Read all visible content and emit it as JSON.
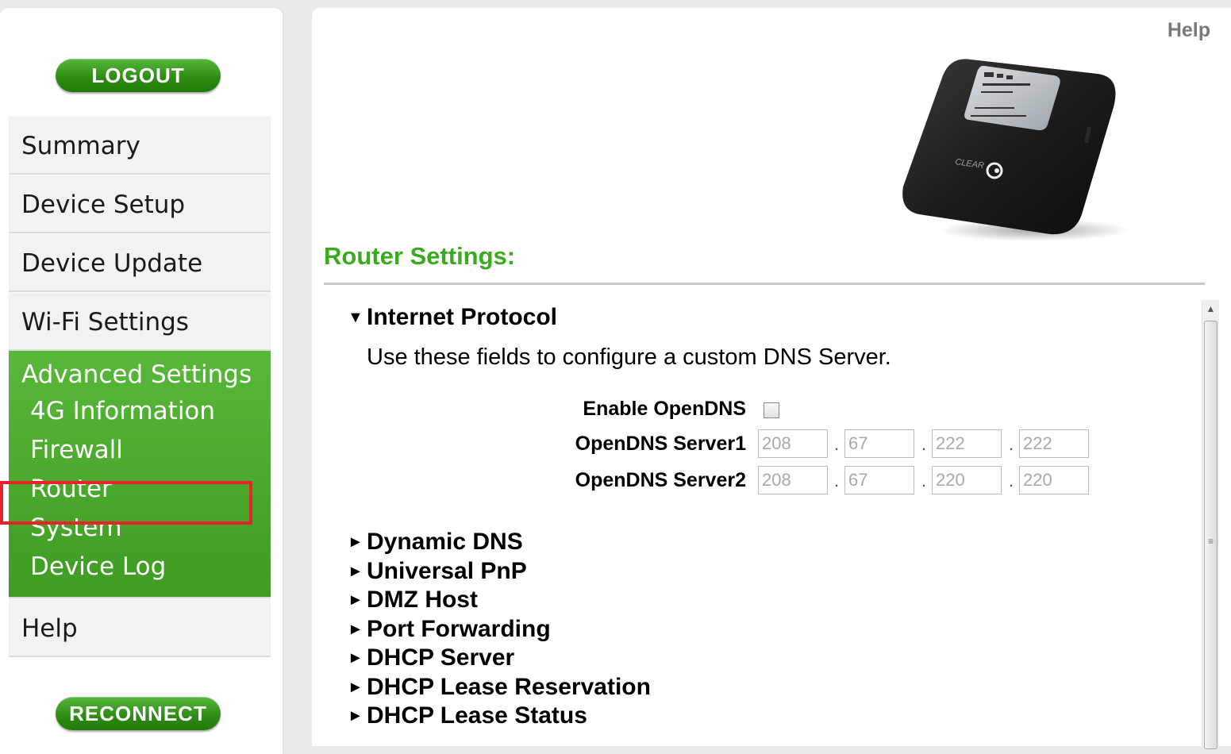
{
  "sidebar": {
    "logout_label": "LOGOUT",
    "reconnect_label": "RECONNECT",
    "nav_top": [
      "Summary",
      "Device Setup",
      "Device Update",
      "Wi-Fi Settings"
    ],
    "advanced": {
      "title": "Advanced Settings",
      "items": [
        "4G Information",
        "Firewall",
        "Router",
        "System",
        "Device Log"
      ],
      "selected": "Router"
    },
    "help_label": "Help"
  },
  "main": {
    "help_link": "Help",
    "device_image": {
      "icon": "clear-hotspot-device",
      "brand_text": "CLEAR"
    },
    "title": "Router Settings:",
    "internet_protocol": {
      "label": "Internet Protocol",
      "expanded": true,
      "description": "Use these fields to configure a custom DNS Server.",
      "enable_label": "Enable OpenDNS",
      "enable_checked": false,
      "server1_label": "OpenDNS Server1",
      "server1": [
        "208",
        "67",
        "222",
        "222"
      ],
      "server2_label": "OpenDNS Server2",
      "server2": [
        "208",
        "67",
        "220",
        "220"
      ]
    },
    "collapsed_sections": [
      "Dynamic DNS",
      "Universal PnP",
      "DMZ Host",
      "Port Forwarding",
      "DHCP Server",
      "DHCP Lease Reservation",
      "DHCP Lease Status"
    ]
  },
  "colors": {
    "accent_green": "#3aab1e",
    "nav_green": "#4aa82a",
    "highlight_red": "#e8232a"
  }
}
